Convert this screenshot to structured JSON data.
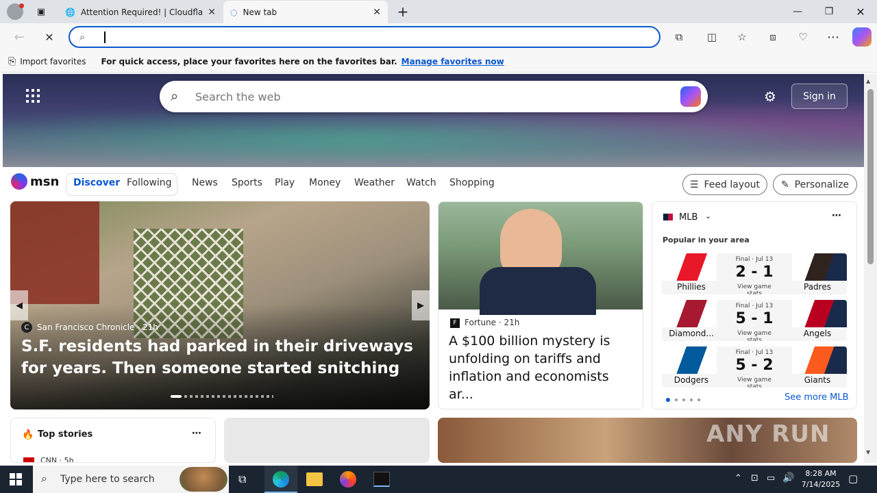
{
  "browser": {
    "tabs": [
      {
        "title": "Attention Required! | Cloudflare",
        "icon": "globe-icon"
      },
      {
        "title": "New tab",
        "icon": "loading-icon"
      }
    ],
    "address_value": "",
    "favbar": {
      "import_label": "Import favorites",
      "message": "For quick access, place your favorites here on the favorites bar.",
      "manage_link": "Manage favorites now"
    }
  },
  "msn": {
    "search_placeholder": "Search the web",
    "sign_in": "Sign in",
    "logo": "msn",
    "nav": [
      "Discover",
      "Following",
      "News",
      "Sports",
      "Play",
      "Money",
      "Weather",
      "Watch",
      "Shopping"
    ],
    "feed_layout": "Feed layout",
    "personalize": "Personalize",
    "hero_story": {
      "source": "San Francisco Chronicle",
      "age": "21h",
      "headline": "S.F. residents had parked in their driveways for years. Then someone started snitching"
    },
    "story2": {
      "source": "Fortune",
      "age": "21h",
      "headline": "A $100 billion mystery is unfolding on tariffs and inflation and economists ar..."
    },
    "mlb": {
      "title": "MLB",
      "subtitle": "Popular in your area",
      "see_more": "See more MLB",
      "games": [
        {
          "status": "Final · Jul 13",
          "score": "2 - 1",
          "stats": "View game stats",
          "home": "Phillies",
          "away": "Padres",
          "home_color": "#e81828",
          "away_color": "#2f241d"
        },
        {
          "status": "Final · Jul 13",
          "score": "5 - 1",
          "stats": "View game stats",
          "home": "Diamond...",
          "away": "Angels",
          "home_color": "#a71930",
          "away_color": "#ba0021"
        },
        {
          "status": "Final · Jul 13",
          "score": "5 - 2",
          "stats": "View game stats",
          "home": "Dodgers",
          "away": "Giants",
          "home_color": "#005a9c",
          "away_color": "#fd5a1e"
        }
      ]
    },
    "top_stories": {
      "title": "Top stories",
      "first_source": "CNN · 5h"
    },
    "watermark": "ANY RUN"
  },
  "taskbar": {
    "search_placeholder": "Type here to search",
    "time": "8:28 AM",
    "date": "7/14/2025"
  }
}
